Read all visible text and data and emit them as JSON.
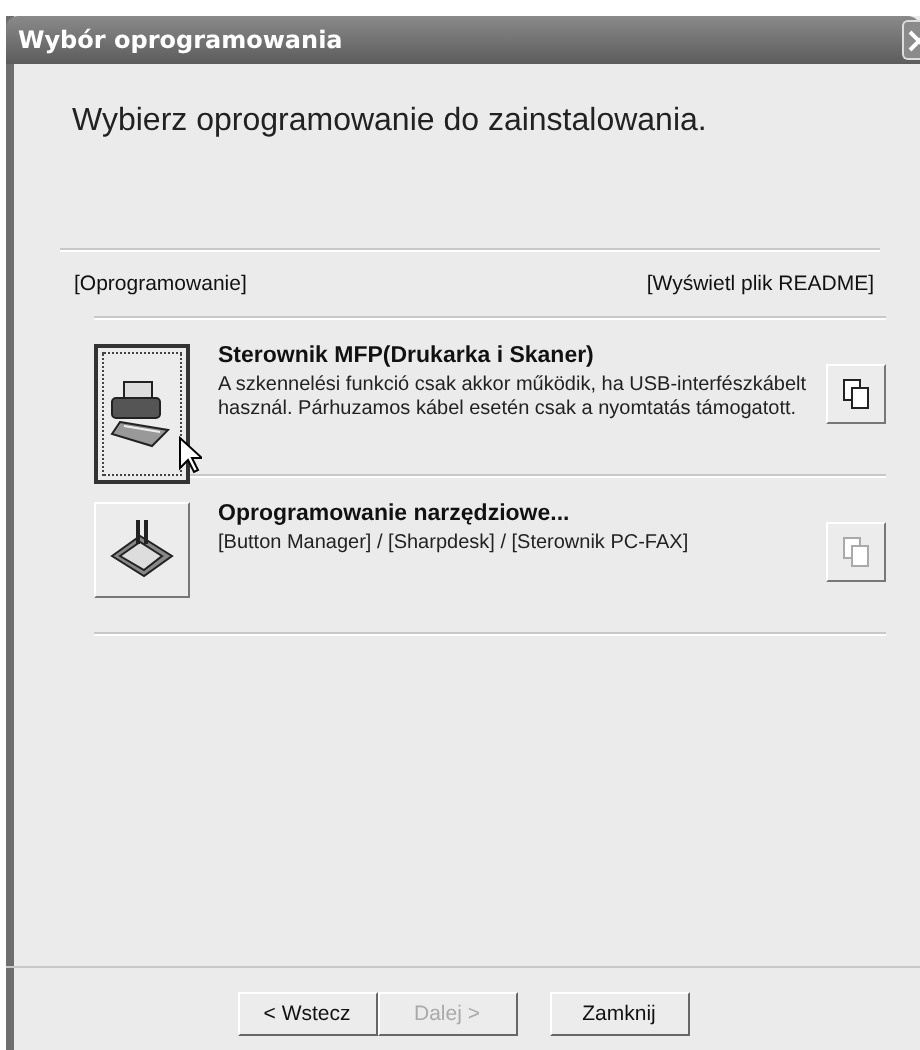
{
  "window": {
    "title": "Wybór oprogramowania"
  },
  "heading": "Wybierz oprogramowanie do zainstalowania.",
  "list_header": {
    "left": "[Oprogramowanie]",
    "right": "[Wyświetl plik README]"
  },
  "items": [
    {
      "kind": "printer",
      "title": "Sterownik MFP(Drukarka i Skaner)",
      "description": "A szkennelési funkció csak akkor működik, ha USB-interfészkábelt használ. Párhuzamos kábel esetén csak a nyomtatás támogatott.",
      "focused": true,
      "readme_disabled": false
    },
    {
      "kind": "tools",
      "title": "Oprogramowanie narzędziowe...",
      "description": "[Button Manager] / [Sharpdesk] / [Sterownik PC-FAX]",
      "focused": false,
      "readme_disabled": true
    }
  ],
  "buttons": [
    {
      "label": "< Wstecz",
      "disabled": false
    },
    {
      "label": "Dalej >",
      "disabled": true
    },
    {
      "label": "Zamknij",
      "disabled": false
    }
  ]
}
